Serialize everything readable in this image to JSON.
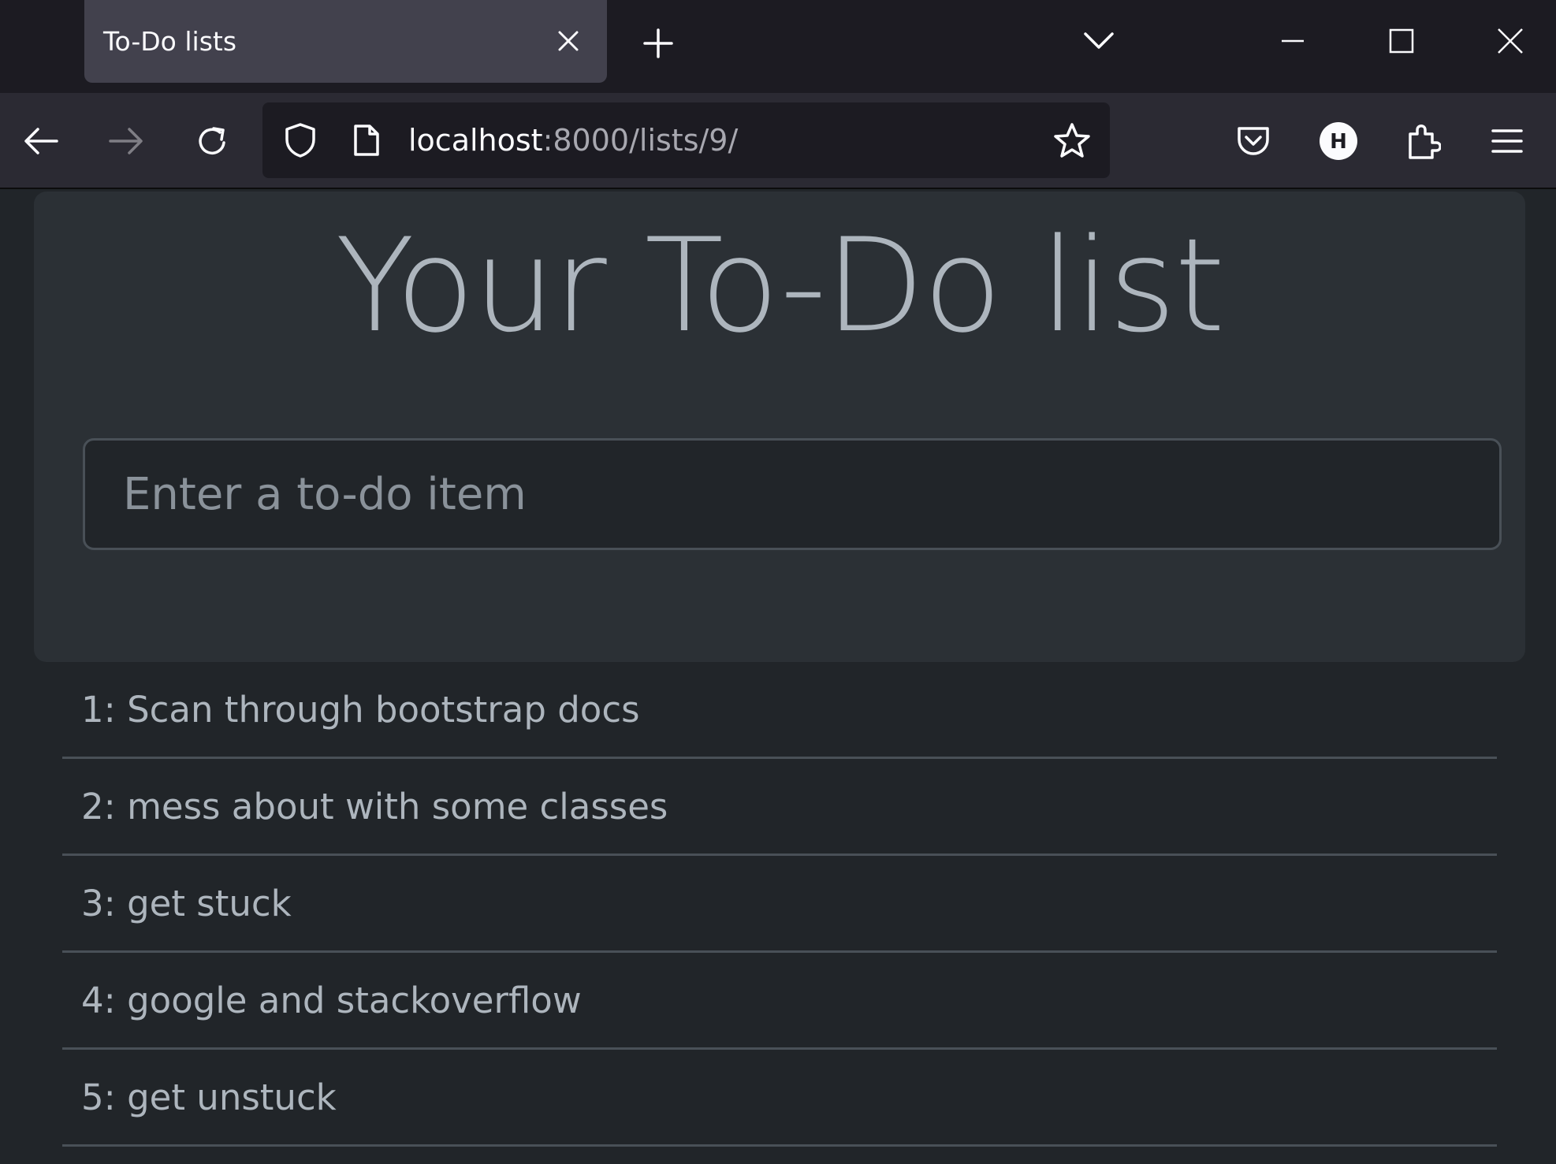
{
  "browser": {
    "tab": {
      "title": "To-Do lists"
    },
    "address_bar": {
      "host": "localhost",
      "path": ":8000/lists/9/"
    },
    "account_initial": "H",
    "icons": {
      "tab_close": "close-icon",
      "new_tab": "plus-icon",
      "tab_list": "chevron-down-icon",
      "minimize": "minimize-icon",
      "maximize": "maximize-icon",
      "window_close": "close-icon",
      "back": "arrow-left-icon",
      "forward": "arrow-right-icon",
      "reload": "reload-icon",
      "tracking_protection": "shield-icon",
      "page_info": "page-icon",
      "bookmark": "star-icon",
      "pocket": "pocket-icon",
      "account": "account-icon",
      "extensions": "puzzle-icon",
      "menu": "hamburger-menu-icon"
    }
  },
  "page": {
    "heading": "Your To-Do list",
    "input": {
      "placeholder": "Enter a to-do item",
      "value": ""
    },
    "items": [
      "1: Scan through bootstrap docs",
      "2: mess about with some classes",
      "3: get stuck",
      "4: google and stackoverflow",
      "5: get unstuck"
    ]
  },
  "colors": {
    "page_background": "#212529",
    "jumbotron_background": "#2b3035",
    "text": "#adb5bd",
    "divider": "#495057"
  }
}
